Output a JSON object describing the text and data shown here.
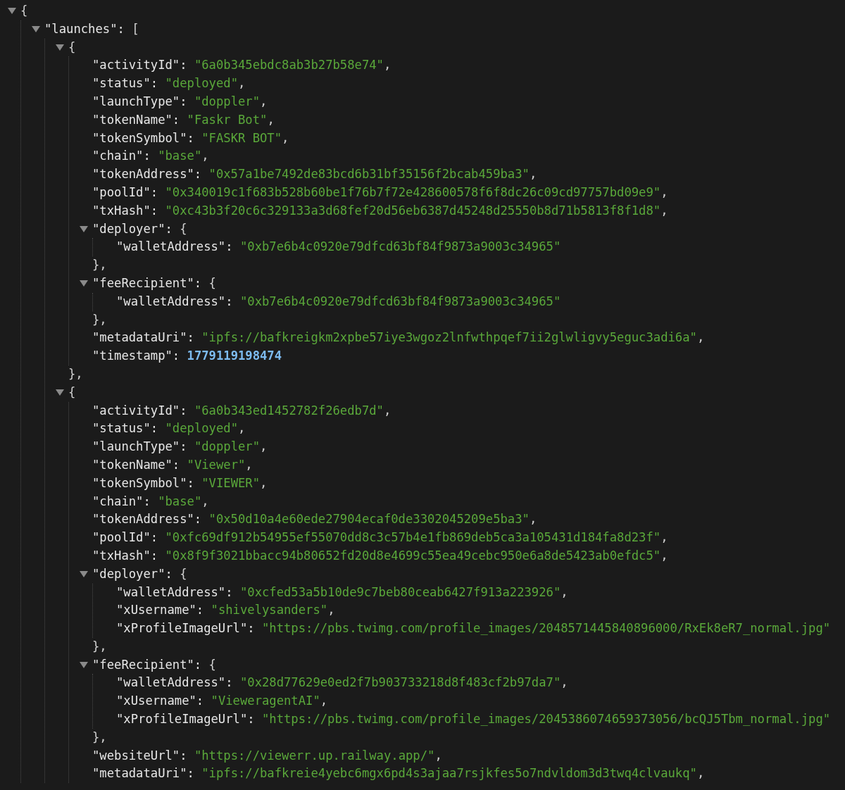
{
  "tree": {
    "kind": "object",
    "open": "{",
    "expanded": true,
    "children": [
      {
        "kind": "object",
        "key": "\"launches\":",
        "open": "[",
        "expanded": true,
        "children": [
          {
            "kind": "object",
            "open": "{",
            "expanded": true,
            "close": "},",
            "children": [
              {
                "kind": "string",
                "key": "\"activityId\":",
                "value": "\"6a0b345ebdc8ab3b27b58e74\"",
                "punct": ","
              },
              {
                "kind": "string",
                "key": "\"status\":",
                "value": "\"deployed\"",
                "punct": ","
              },
              {
                "kind": "string",
                "key": "\"launchType\":",
                "value": "\"doppler\"",
                "punct": ","
              },
              {
                "kind": "string",
                "key": "\"tokenName\":",
                "value": "\"Faskr Bot\"",
                "punct": ","
              },
              {
                "kind": "string",
                "key": "\"tokenSymbol\":",
                "value": "\"FASKR BOT\"",
                "punct": ","
              },
              {
                "kind": "string",
                "key": "\"chain\":",
                "value": "\"base\"",
                "punct": ","
              },
              {
                "kind": "string",
                "key": "\"tokenAddress\":",
                "value": "\"0x57a1be7492de83bcd6b31bf35156f2bcab459ba3\"",
                "punct": ","
              },
              {
                "kind": "string",
                "key": "\"poolId\":",
                "value": "\"0x340019c1f683b528b60be1f76b7f72e428600578f6f8dc26c09cd97757bd09e9\"",
                "punct": ","
              },
              {
                "kind": "string",
                "key": "\"txHash\":",
                "value": "\"0xc43b3f20c6c329133a3d68fef20d56eb6387d45248d25550b8d71b5813f8f1d8\"",
                "punct": ","
              },
              {
                "kind": "object",
                "key": "\"deployer\":",
                "open": "{",
                "expanded": true,
                "close": "},",
                "children": [
                  {
                    "kind": "string",
                    "key": "\"walletAddress\":",
                    "value": "\"0xb7e6b4c0920e79dfcd63bf84f9873a9003c34965\""
                  }
                ]
              },
              {
                "kind": "object",
                "key": "\"feeRecipient\":",
                "open": "{",
                "expanded": true,
                "close": "},",
                "children": [
                  {
                    "kind": "string",
                    "key": "\"walletAddress\":",
                    "value": "\"0xb7e6b4c0920e79dfcd63bf84f9873a9003c34965\""
                  }
                ]
              },
              {
                "kind": "string",
                "key": "\"metadataUri\":",
                "value": "\"ipfs://bafkreigkm2xpbe57iye3wgoz2lnfwthpqef7ii2glwligvy5eguc3adi6a\"",
                "punct": ","
              },
              {
                "kind": "number",
                "key": "\"timestamp\":",
                "value": "1779119198474"
              }
            ]
          },
          {
            "kind": "object",
            "open": "{",
            "expanded": true,
            "children": [
              {
                "kind": "string",
                "key": "\"activityId\":",
                "value": "\"6a0b343ed1452782f26edb7d\"",
                "punct": ","
              },
              {
                "kind": "string",
                "key": "\"status\":",
                "value": "\"deployed\"",
                "punct": ","
              },
              {
                "kind": "string",
                "key": "\"launchType\":",
                "value": "\"doppler\"",
                "punct": ","
              },
              {
                "kind": "string",
                "key": "\"tokenName\":",
                "value": "\"Viewer\"",
                "punct": ","
              },
              {
                "kind": "string",
                "key": "\"tokenSymbol\":",
                "value": "\"VIEWER\"",
                "punct": ","
              },
              {
                "kind": "string",
                "key": "\"chain\":",
                "value": "\"base\"",
                "punct": ","
              },
              {
                "kind": "string",
                "key": "\"tokenAddress\":",
                "value": "\"0x50d10a4e60ede27904ecaf0de3302045209e5ba3\"",
                "punct": ","
              },
              {
                "kind": "string",
                "key": "\"poolId\":",
                "value": "\"0xfc69df912b54955ef55070dd8c3c57b4e1fb869deb5ca3a105431d184fa8d23f\"",
                "punct": ","
              },
              {
                "kind": "string",
                "key": "\"txHash\":",
                "value": "\"0x8f9f3021bbacc94b80652fd20d8e4699c55ea49cebc950e6a8de5423ab0efdc5\"",
                "punct": ","
              },
              {
                "kind": "object",
                "key": "\"deployer\":",
                "open": "{",
                "expanded": true,
                "close": "},",
                "children": [
                  {
                    "kind": "string",
                    "key": "\"walletAddress\":",
                    "value": "\"0xcfed53a5b10de9c7beb80ceab6427f913a223926\"",
                    "punct": ","
                  },
                  {
                    "kind": "string",
                    "key": "\"xUsername\":",
                    "value": "\"shivelysanders\"",
                    "punct": ","
                  },
                  {
                    "kind": "string",
                    "key": "\"xProfileImageUrl\":",
                    "value": "\"https://pbs.twimg.com/profile_images/2048571445840896000/RxEk8eR7_normal.jpg\""
                  }
                ]
              },
              {
                "kind": "object",
                "key": "\"feeRecipient\":",
                "open": "{",
                "expanded": true,
                "close": "},",
                "children": [
                  {
                    "kind": "string",
                    "key": "\"walletAddress\":",
                    "value": "\"0x28d77629e0ed2f7b903733218d8f483cf2b97da7\"",
                    "punct": ","
                  },
                  {
                    "kind": "string",
                    "key": "\"xUsername\":",
                    "value": "\"VieweragentAI\"",
                    "punct": ","
                  },
                  {
                    "kind": "string",
                    "key": "\"xProfileImageUrl\":",
                    "value": "\"https://pbs.twimg.com/profile_images/2045386074659373056/bcQJ5Tbm_normal.jpg\""
                  }
                ]
              },
              {
                "kind": "string",
                "key": "\"websiteUrl\":",
                "value": "\"https://viewerr.up.railway.app/\"",
                "punct": ","
              },
              {
                "kind": "string",
                "key": "\"metadataUri\":",
                "value": "\"ipfs://bafkreie4yebc6mgx6pd4s3ajaa7rsjkfes5o7ndvldom3d3twq4clvaukq\"",
                "punct": ","
              }
            ]
          }
        ]
      }
    ]
  }
}
